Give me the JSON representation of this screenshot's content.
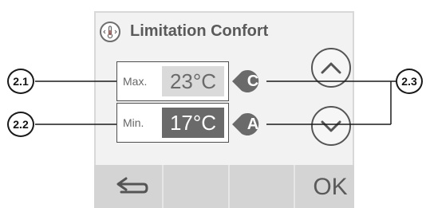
{
  "title": "Limitation Confort",
  "max": {
    "label": "Max.",
    "value": "23°C",
    "tag": "C"
  },
  "min": {
    "label": "Min.",
    "value": "17°C",
    "tag": "A"
  },
  "footer": {
    "ok_label": "OK"
  },
  "callouts": {
    "max": "2.1",
    "min": "2.2",
    "arrows": "2.3"
  },
  "icons": {
    "title": "thermometer-icon",
    "up": "chevron-up-icon",
    "down": "chevron-down-icon",
    "back": "back-arrow-icon"
  },
  "colors": {
    "value_selected_bg": "#6a6a6a",
    "value_bg": "#dadada",
    "tag": "#6a6a6a"
  }
}
